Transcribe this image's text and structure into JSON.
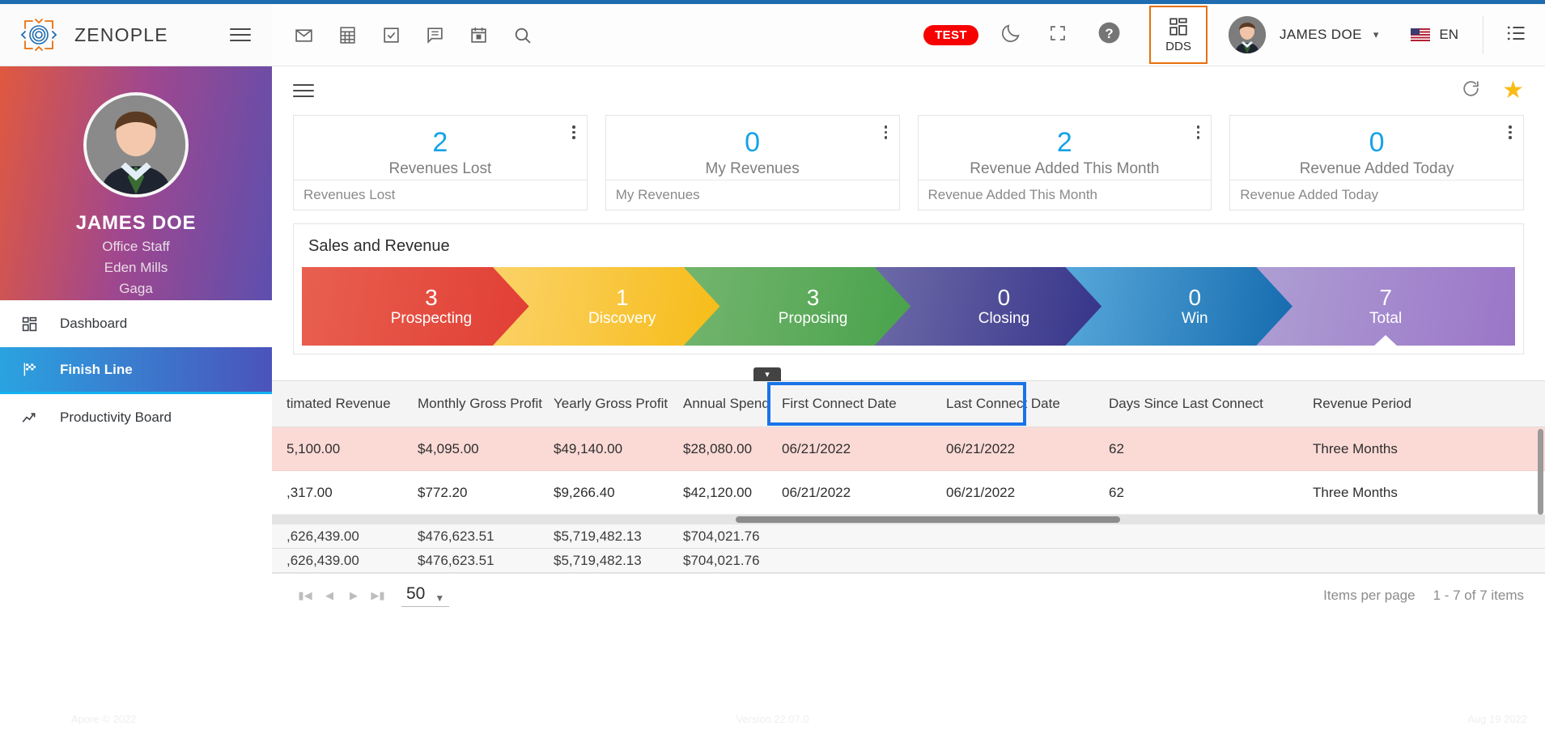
{
  "brand": {
    "name": "ZENOPLE",
    "logo_icon": "zenople-target-icon",
    "menu_icon": "hamburger-menu-icon"
  },
  "header": {
    "icons": [
      "mail-icon",
      "calculator-icon",
      "task-check-icon",
      "message-icon",
      "calendar-icon",
      "search-icon"
    ],
    "environment_badge": "TEST",
    "dark_mode_icon": "moon-icon",
    "fullscreen_icon": "fullscreen-icon",
    "help_icon": "help-question-icon",
    "apps_label": "DDS",
    "apps_icon": "grid-apps-icon",
    "user_name": "JAMES DOE",
    "user_caret_icon": "chevron-down-icon",
    "language": "EN",
    "flag_icon": "us-flag-icon",
    "list_icon": "list-menu-icon"
  },
  "sidebar": {
    "profile": {
      "avatar": "user-avatar",
      "name": "JAMES DOE",
      "role": "Office Staff",
      "location": "Eden Mills",
      "company": "Gaga"
    },
    "items": [
      {
        "label": "Dashboard",
        "icon": "grid-dashboard-icon",
        "active": false
      },
      {
        "label": "Finish Line",
        "icon": "checkered-flag-icon",
        "active": true
      },
      {
        "label": "Productivity Board",
        "icon": "trend-up-icon",
        "active": false
      }
    ],
    "footer": "Apore © 2022"
  },
  "main": {
    "toolbar": {
      "menu_icon": "hamburger-menu-icon",
      "refresh_icon": "refresh-icon",
      "favorite_icon": "star-icon"
    },
    "kpis": [
      {
        "value": "2",
        "caption": "Revenues Lost",
        "footer": "Revenues Lost",
        "menu_icon": "more-vertical-icon"
      },
      {
        "value": "0",
        "caption": "My Revenues",
        "footer": "My Revenues",
        "menu_icon": "more-vertical-icon"
      },
      {
        "value": "2",
        "caption": "Revenue Added This Month",
        "footer": "Revenue Added This Month",
        "menu_icon": "more-vertical-icon"
      },
      {
        "value": "0",
        "caption": "Revenue Added Today",
        "footer": "Revenue Added Today",
        "menu_icon": "more-vertical-icon"
      }
    ],
    "sales_panel": {
      "title": "Sales and Revenue"
    },
    "grid": {
      "collapse_icon": "chevron-down-icon",
      "columns": [
        "timated Revenue",
        "Monthly Gross Profit",
        "Yearly Gross Profit",
        "Annual Spend",
        "First Connect Date",
        "Last Connect Date",
        "Days Since Last Connect",
        "Revenue Period"
      ],
      "rows": [
        {
          "highlighted": true,
          "cells": [
            "5,100.00",
            "$4,095.00",
            "$49,140.00",
            "$28,080.00",
            "06/21/2022",
            "06/21/2022",
            "62",
            "Three Months"
          ]
        },
        {
          "highlighted": false,
          "cells": [
            ",317.00",
            "$772.20",
            "$9,266.40",
            "$42,120.00",
            "06/21/2022",
            "06/21/2022",
            "62",
            "Three Months"
          ]
        }
      ],
      "summary_rows": [
        [
          ",626,439.00",
          "$476,623.51",
          "$5,719,482.13",
          "$704,021.76",
          "",
          "",
          "",
          ""
        ],
        [
          ",626,439.00",
          "$476,623.51",
          "$5,719,482.13",
          "$704,021.76",
          "",
          "",
          "",
          ""
        ]
      ]
    },
    "pager": {
      "first_icon": "page-first-icon",
      "prev_icon": "page-prev-icon",
      "next_icon": "page-next-icon",
      "last_icon": "page-last-icon",
      "page_size": "50",
      "page_size_caret": "dropdown-arrow-icon",
      "items_per_page_label": "Items per page",
      "range_label": "1 - 7 of 7 items"
    }
  },
  "chart_data": {
    "type": "bar",
    "title": "Sales and Revenue",
    "categories": [
      "Prospecting",
      "Discovery",
      "Proposing",
      "Closing",
      "Win",
      "Total"
    ],
    "values": [
      3,
      1,
      3,
      0,
      0,
      7
    ],
    "colors": [
      "#e03a31",
      "#f6b90d",
      "#43a047",
      "#2f2d86",
      "#0c63a8",
      "#9b76c8"
    ],
    "xlabel": "",
    "ylabel": "",
    "legend": "none",
    "grid": false
  },
  "footer": {
    "left": "Apore © 2022",
    "middle": "Version 22.07.0",
    "right": "Aug 19 2022"
  }
}
